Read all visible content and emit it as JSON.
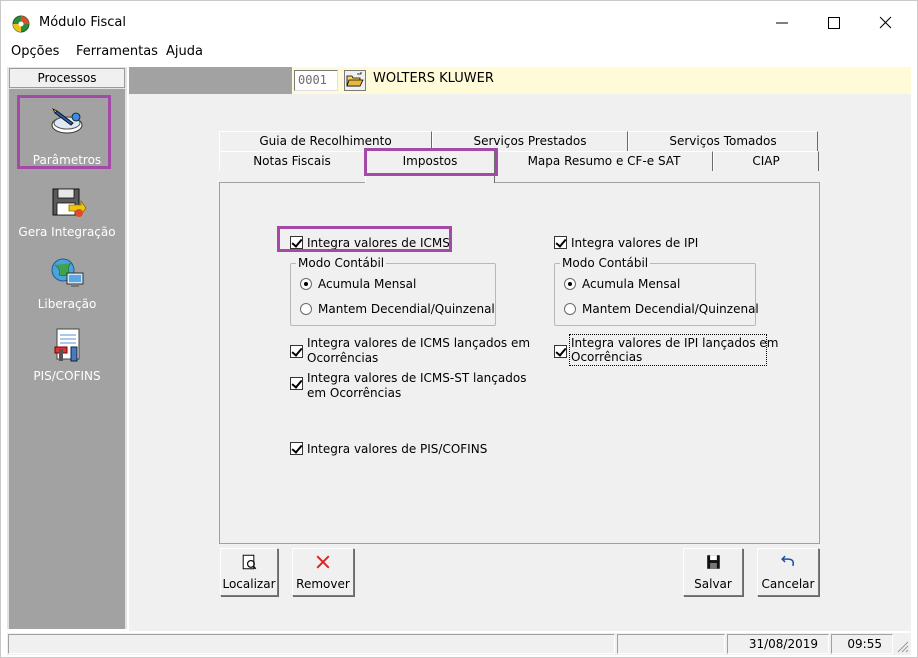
{
  "window": {
    "title": "Módulo Fiscal",
    "minimize": "—",
    "maximize": "☐",
    "close": "✕"
  },
  "menu": [
    "Opções",
    "Ferramentas",
    "Ajuda"
  ],
  "sidebar": {
    "header": "Processos",
    "items": [
      {
        "label": "Parâmetros",
        "icon": "settings-pencil-icon",
        "selected": true
      },
      {
        "label": "Gera Integração",
        "icon": "floppy-export-icon"
      },
      {
        "label": "Liberação",
        "icon": "globe-computer-icon"
      },
      {
        "label": "PIS/COFINS",
        "icon": "document-tools-icon"
      }
    ]
  },
  "company": {
    "code": "0001",
    "name": "WOLTERS KLUWER"
  },
  "tabs": {
    "row_back": [
      "Guia de Recolhimento",
      "Serviços Prestados",
      "Serviços Tomados"
    ],
    "row_front": [
      "Notas Fiscais",
      "Impostos",
      "Mapa Resumo e CF-e SAT",
      "CIAP"
    ],
    "active": "Impostos"
  },
  "icms": {
    "integra_label": "Integra valores de ICMS",
    "integra_checked": true,
    "modo_title": "Modo Contábil",
    "modo_options": [
      "Acumula Mensal",
      "Mantem Decendial/Quinzenal"
    ],
    "modo_selected": "Acumula Mensal",
    "ocorrencias_line1": "Integra valores de ICMS lançados em",
    "ocorrencias_line2": "Ocorrências",
    "ocorrencias_checked": true,
    "st_line1": "Integra valores de ICMS-ST lançados",
    "st_line2": "em Ocorrências",
    "st_checked": true
  },
  "ipi": {
    "integra_label": "Integra valores de IPI",
    "integra_checked": true,
    "modo_title": "Modo Contábil",
    "modo_options": [
      "Acumula Mensal",
      "Mantem Decendial/Quinzenal"
    ],
    "modo_selected": "Acumula Mensal",
    "ocorrencias_line1": "Integra valores de IPI lançados em",
    "ocorrencias_line2": "Ocorrências",
    "ocorrencias_checked": true
  },
  "pis_cofins": {
    "label": "Integra valores de PIS/COFINS",
    "checked": true
  },
  "buttons": {
    "localizar": "Localizar",
    "remover": "Remover",
    "salvar": "Salvar",
    "cancelar": "Cancelar"
  },
  "status": {
    "date": "31/08/2019",
    "time": "09:55"
  },
  "colors": {
    "highlight": "#a24aa6",
    "nav_bg": "#a2a2a2",
    "info_bg": "#fffbd8"
  }
}
